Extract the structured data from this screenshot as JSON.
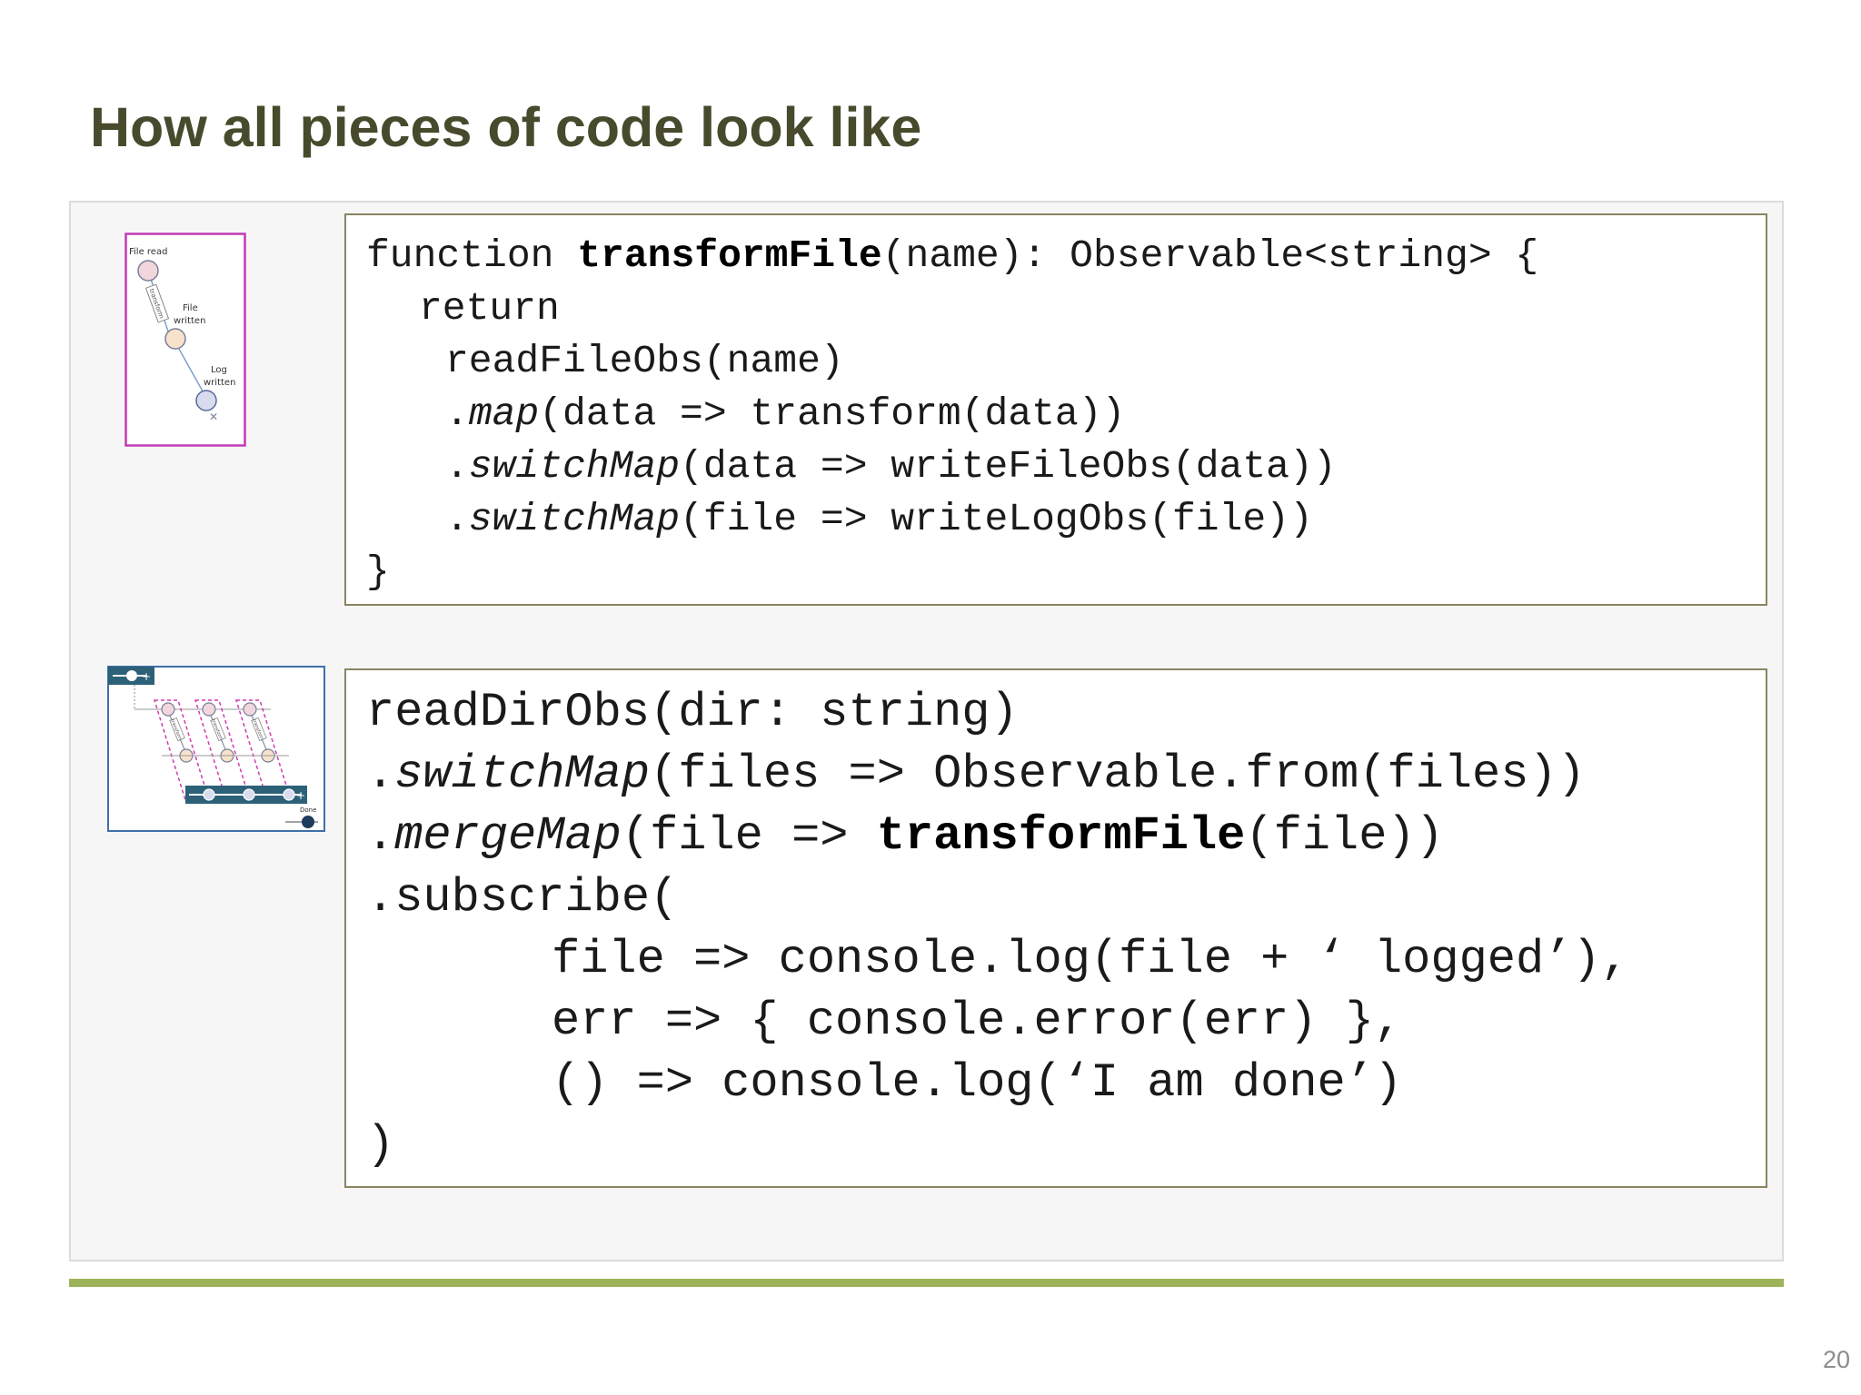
{
  "slide": {
    "title": "How all pieces of code look like",
    "page_number": "20"
  },
  "diagram_small": {
    "label_file_read": "File read",
    "label_transform": "transform",
    "label_file": "File",
    "label_written": "written",
    "label_log": "Log",
    "label_log_written": "written"
  },
  "diagram_dir": {
    "label_transform": "transform",
    "label_done": "Done"
  },
  "code_block_1": {
    "l1a": "function ",
    "l1b": "transformFile",
    "l1c": "(name): Observable<string> {",
    "l2": "return",
    "l3": "readFileObs(name)",
    "l4a": ".",
    "l4b": "map",
    "l4c": "(data => transform(data))",
    "l5a": ".",
    "l5b": "switchMap",
    "l5c": "(data => writeFileObs(data))",
    "l6a": ".",
    "l6b": "switchMap",
    "l6c": "(file => writeLogObs(file))",
    "l7": "}"
  },
  "code_block_2": {
    "l1": "readDirObs(dir: string)",
    "l2a": ".",
    "l2b": "switchMap",
    "l2c": "(files => Observable.from(files))",
    "l3a": ".",
    "l3b": "mergeMap",
    "l3c": "(file => ",
    "l3d": "transformFile",
    "l3e": "(file))",
    "l4": ".subscribe(",
    "l5": "file => console.log(file + ‘ logged’),",
    "l6": "err => { console.error(err) },",
    "l7": "() => console.log(‘I am done’)",
    "l8": ")"
  }
}
